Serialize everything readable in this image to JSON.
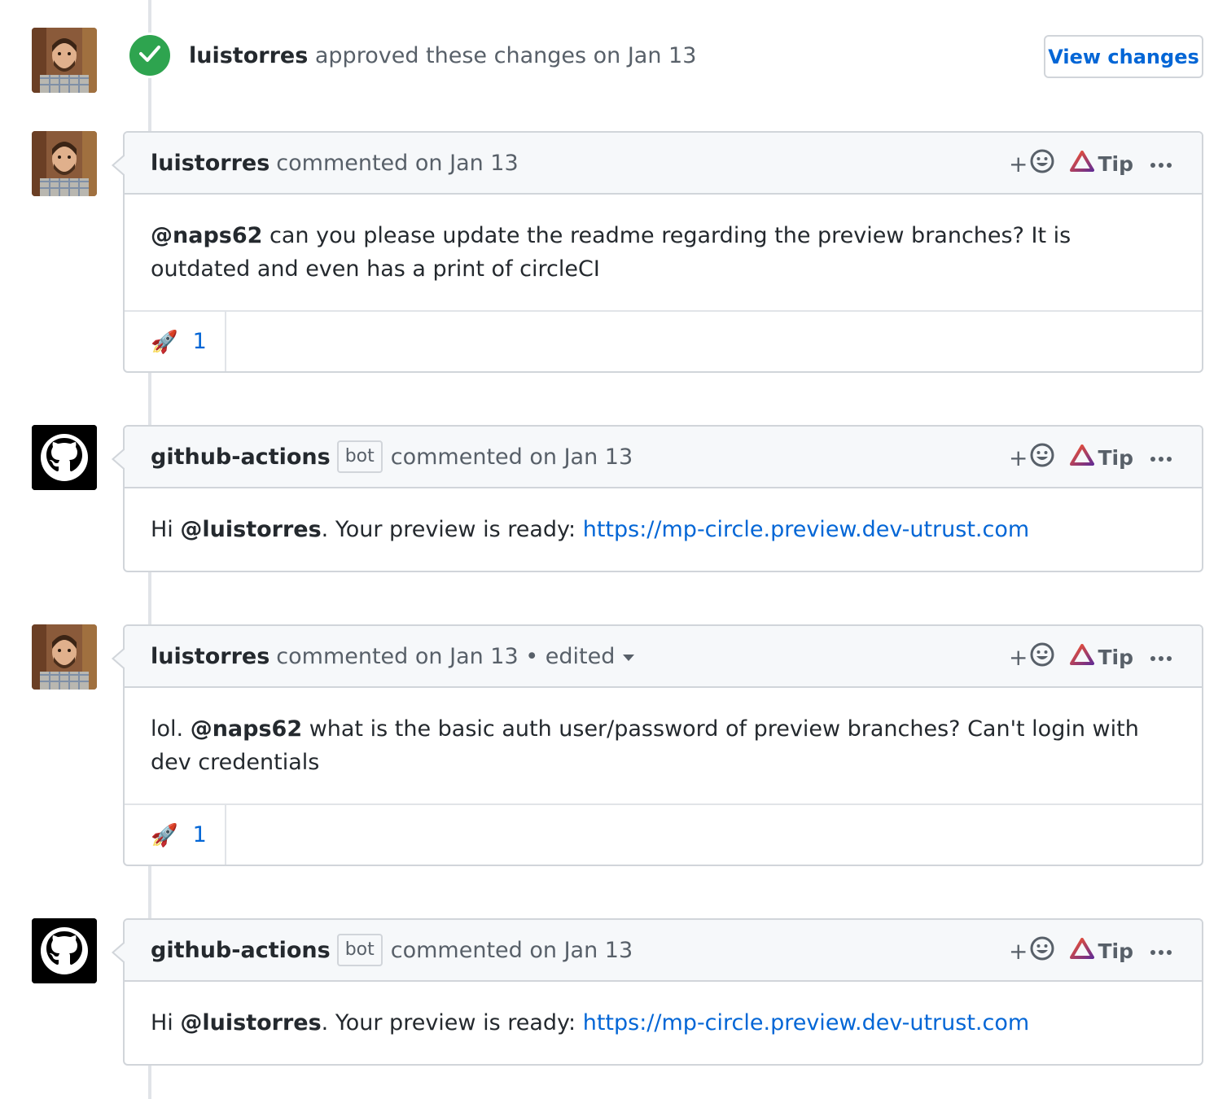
{
  "review": {
    "author": "luistorres",
    "action": "approved these changes on Jan 13",
    "button_label": "View changes"
  },
  "actions": {
    "emoji_plus": "+",
    "tip_label": "Tip"
  },
  "comments": [
    {
      "author": "luistorres",
      "meta": "commented on Jan 13",
      "body": {
        "mention": "@naps62",
        "text": " can you please update the readme regarding the preview branches? It is outdated and even has a print of circleCI"
      },
      "reaction": {
        "emoji": "🚀",
        "count": "1"
      }
    },
    {
      "author": "github-actions",
      "bot_label": "bot",
      "meta": "commented on Jan 13",
      "body": {
        "prefix": "Hi ",
        "mention": "@luistorres",
        "middle": ". Your preview is ready: ",
        "link": "https://mp-circle.preview.dev-utrust.com"
      }
    },
    {
      "author": "luistorres",
      "meta": "commented on Jan 13 • edited",
      "body": {
        "prefix": "lol. ",
        "mention": "@naps62",
        "text": " what is the basic auth user/password of preview branches? Can't login with dev credentials"
      },
      "reaction": {
        "emoji": "🚀",
        "count": "1"
      }
    },
    {
      "author": "github-actions",
      "bot_label": "bot",
      "meta": "commented on Jan 13",
      "body": {
        "prefix": "Hi ",
        "mention": "@luistorres",
        "middle": ". Your preview is ready: ",
        "link": "https://mp-circle.preview.dev-utrust.com"
      }
    }
  ],
  "colors": {
    "approved_green": "#2ea44f",
    "link_blue": "#0366d6",
    "border_gray": "#d1d5da",
    "header_bg": "#f6f8fa"
  },
  "icons": [
    "check-icon",
    "smiley-icon",
    "brave-tip-icon",
    "kebab-icon",
    "github-octocat-icon",
    "chevron-down-icon"
  ]
}
